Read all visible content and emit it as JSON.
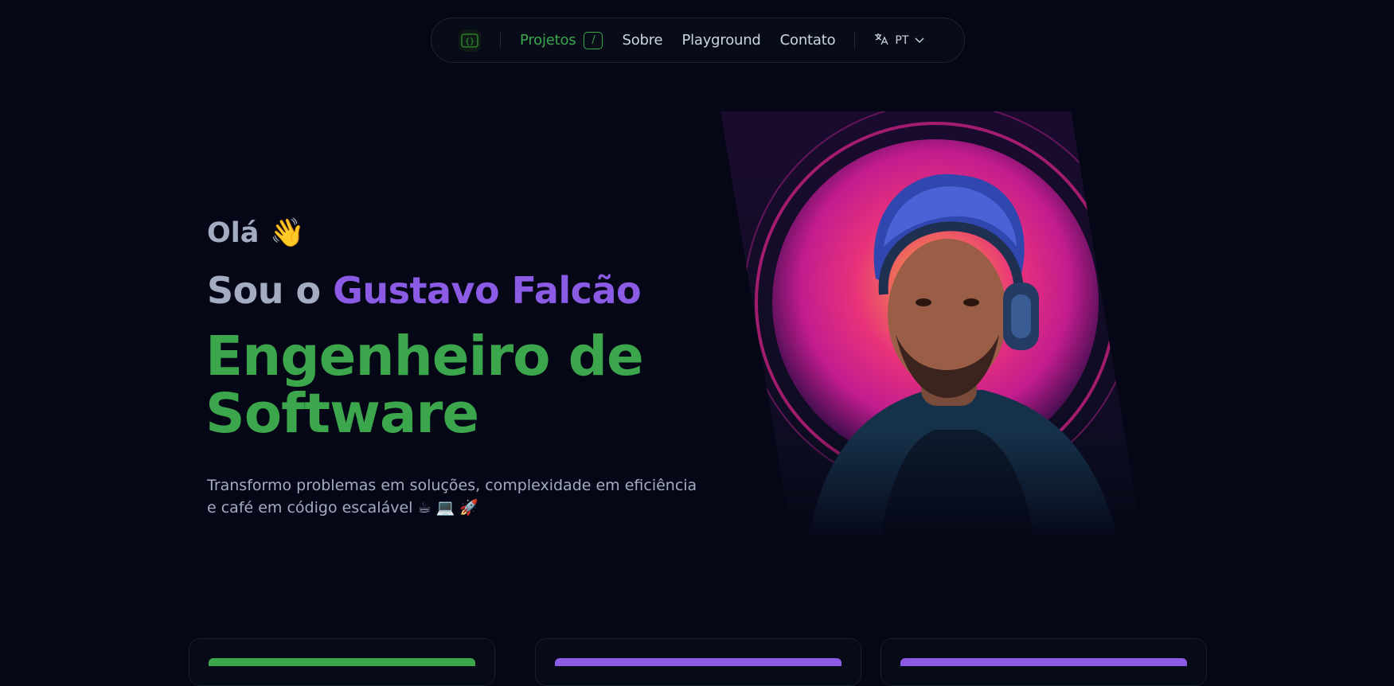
{
  "nav": {
    "logo_icon": "code-brackets-logo-icon",
    "items": [
      {
        "label": "Projetos",
        "shortcut": "/",
        "active": true
      },
      {
        "label": "Sobre"
      },
      {
        "label": "Playground"
      },
      {
        "label": "Contato"
      }
    ],
    "language": {
      "icon": "translate-icon",
      "label": "PT",
      "chevron": "chevron-down-icon"
    }
  },
  "hero": {
    "greeting": "Olá",
    "greeting_emoji": "👋",
    "intro_prefix": "Sou o",
    "name": "Gustavo Falcão",
    "role": "Engenheiro de Software",
    "tagline": "Transformo problemas em soluções, complexidade em eficiência e café em código escalável ☕ 💻 🚀"
  },
  "cards": [
    {
      "accent": "#3ba64b"
    },
    {
      "accent": "#8c5be6"
    },
    {
      "accent": "#8c5be6"
    }
  ],
  "colors": {
    "background": "#050716",
    "accent_green": "#3ba64b",
    "accent_purple": "#8c5be6",
    "muted_text": "#a3acc0"
  }
}
